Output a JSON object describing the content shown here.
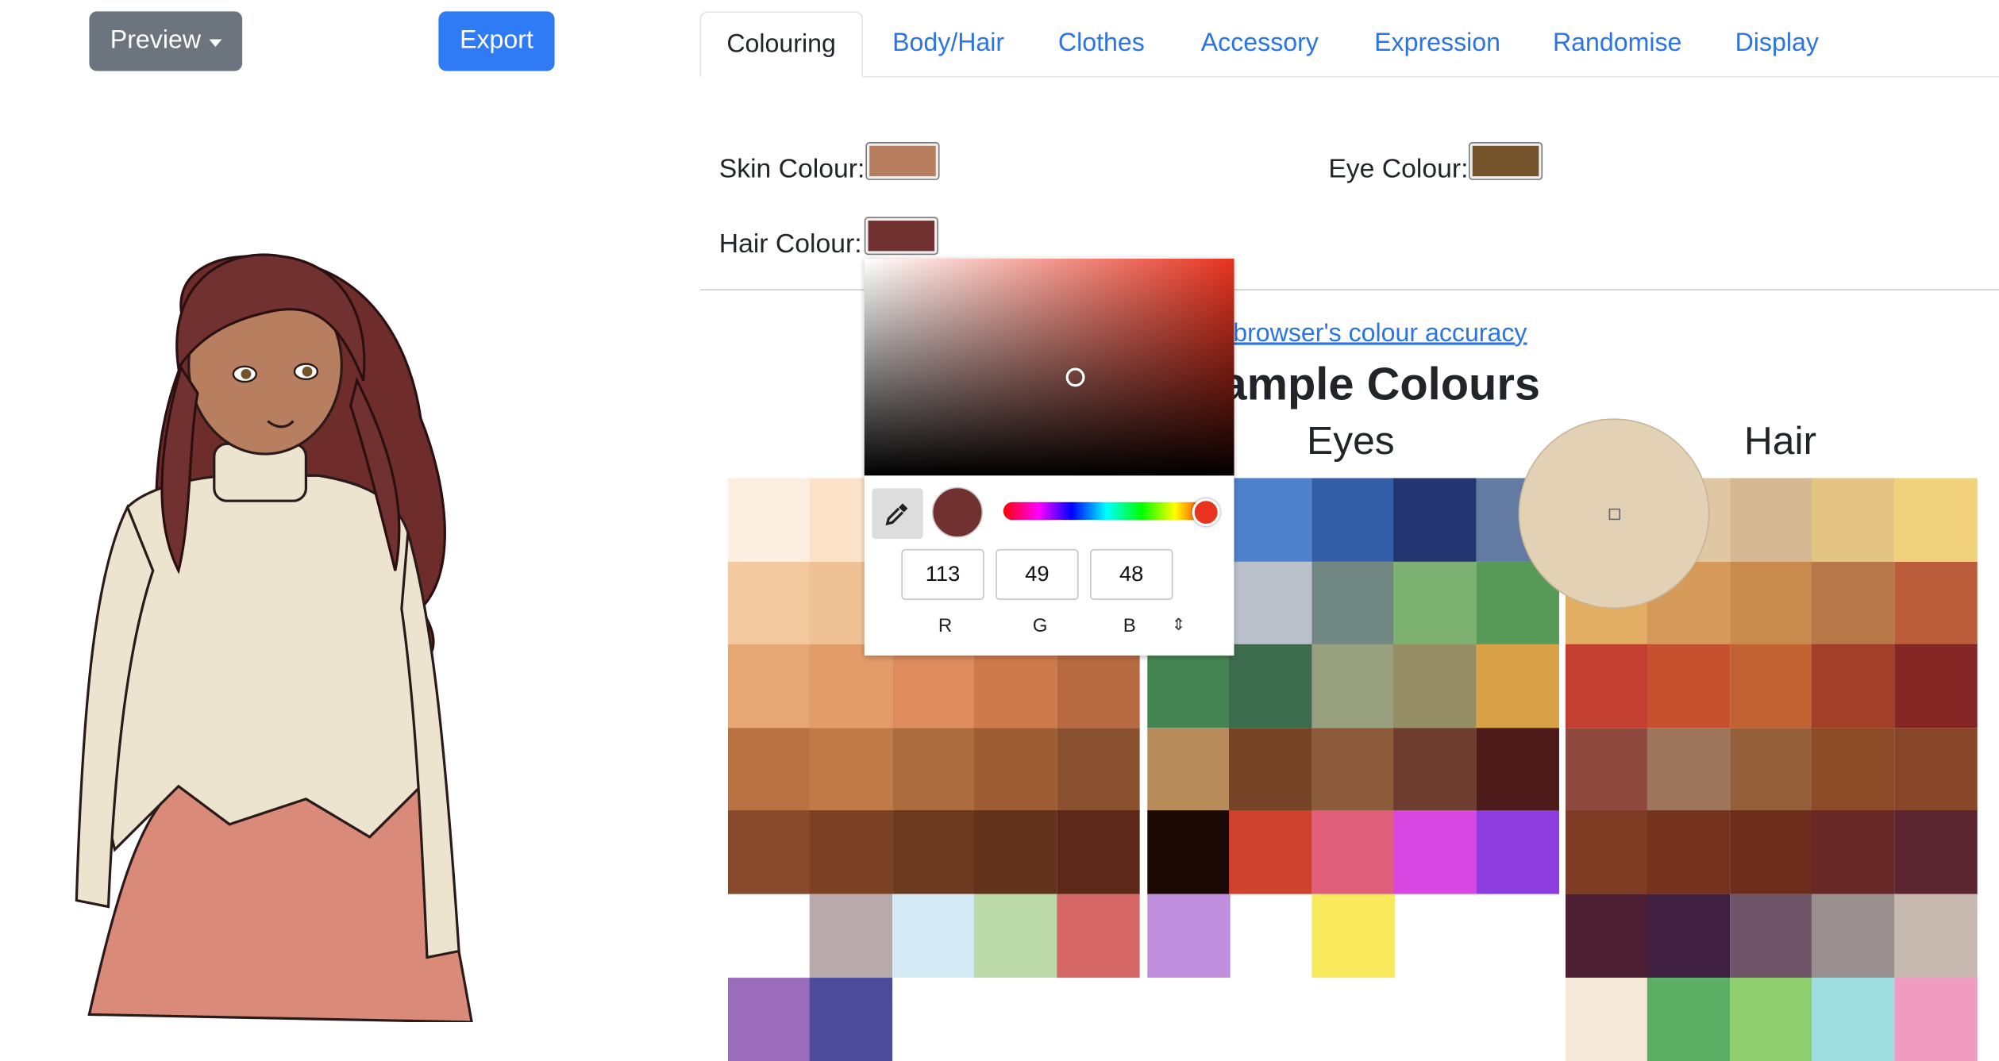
{
  "toolbar": {
    "preview_label": "Preview",
    "export_label": "Export"
  },
  "tabs": [
    {
      "label": "Colouring",
      "active": true
    },
    {
      "label": "Body/Hair"
    },
    {
      "label": "Clothes"
    },
    {
      "label": "Accessory"
    },
    {
      "label": "Expression"
    },
    {
      "label": "Randomise"
    },
    {
      "label": "Display"
    }
  ],
  "colouring": {
    "skin_label": "Skin Colour:",
    "skin_color": "#b77e5f",
    "eye_label": "Eye Colour:",
    "eye_color": "#74532a",
    "hair_label": "Hair Colour:",
    "hair_color": "#713130"
  },
  "accuracy_link": "r browser's colour accuracy",
  "sample_heading": "ample Colours",
  "columns": {
    "eyes": "Eyes",
    "hair": "Hair"
  },
  "picker": {
    "r": "113",
    "g": "49",
    "b": "48",
    "r_label": "R",
    "g_label": "G",
    "b_label": "B",
    "current_color": "#713130",
    "hue_color": "#e8331f",
    "eyedropper_icon": "eyedropper-icon",
    "toggle_icon": "up-down-arrows-icon"
  },
  "skin_swatches": [
    [
      "#fcefe2",
      "#fbe2c8",
      null,
      null,
      null
    ],
    [
      "#f3c9a0",
      "#efc296",
      null,
      null,
      null
    ],
    [
      "#e7a775",
      "#e29b69",
      "#de8b5e",
      "#cf7a4c",
      "#b76a42"
    ],
    [
      "#b97142",
      "#c17b46",
      "#ad6c3e",
      "#9f5d33",
      "#8a5130"
    ],
    [
      "#874a2c",
      "#7a4125",
      "#6b3920",
      "#61321c",
      "#5c2819"
    ],
    [
      null,
      "#b8aaab",
      "#d4ebf5",
      "#bcdaa8",
      "#d66767"
    ],
    [
      "#9a6cbb",
      "#4b4a9b",
      null,
      null,
      null
    ]
  ],
  "eye_swatches": [
    [
      "#4a83d3",
      "#4f82cd",
      "#325ea5",
      "#233671",
      "#637aa3"
    ],
    [
      "#c2cbd6",
      "#bac1cb",
      "#718782",
      "#7db273",
      "#589b58"
    ],
    [
      "#458553",
      "#3c6b4e",
      "#98a07f",
      "#968e64",
      "#d8a047"
    ],
    [
      "#b78b5a",
      "#784427",
      "#8c5b3b",
      "#6d3d2f",
      "#4c1b19"
    ],
    [
      "#1a0805",
      "#cd412d",
      "#e05f7a",
      "#d646e0",
      "#8d3ce0"
    ],
    [
      "#bf8fdd",
      null,
      "#f8e85c",
      null,
      null
    ]
  ],
  "hair_swatches": [
    [
      "#e6c99f",
      "#e0c7a3",
      "#d5b793",
      "#e3c483",
      "#f0d17c"
    ],
    [
      "#e2ae63",
      "#d5995a",
      "#c88b4d",
      "#b9784a",
      "#bb5c3b"
    ],
    [
      "#c33f31",
      "#c6512f",
      "#c06232",
      "#a33e29",
      "#832624"
    ],
    [
      "#8e4a3f",
      "#9c755a",
      "#955f3b",
      "#8d4c27",
      "#874627"
    ],
    [
      "#7e3c25",
      "#75331e",
      "#6c2d1c",
      "#682825",
      "#5b2531"
    ],
    [
      "#4c1f33",
      "#3f2040",
      "#6f5568",
      "#988f8e",
      "#c8b9b0"
    ],
    [
      "#f6e8d9",
      "#5bae63",
      "#8fce6d",
      "#9edee1",
      "#f09cc0"
    ]
  ]
}
